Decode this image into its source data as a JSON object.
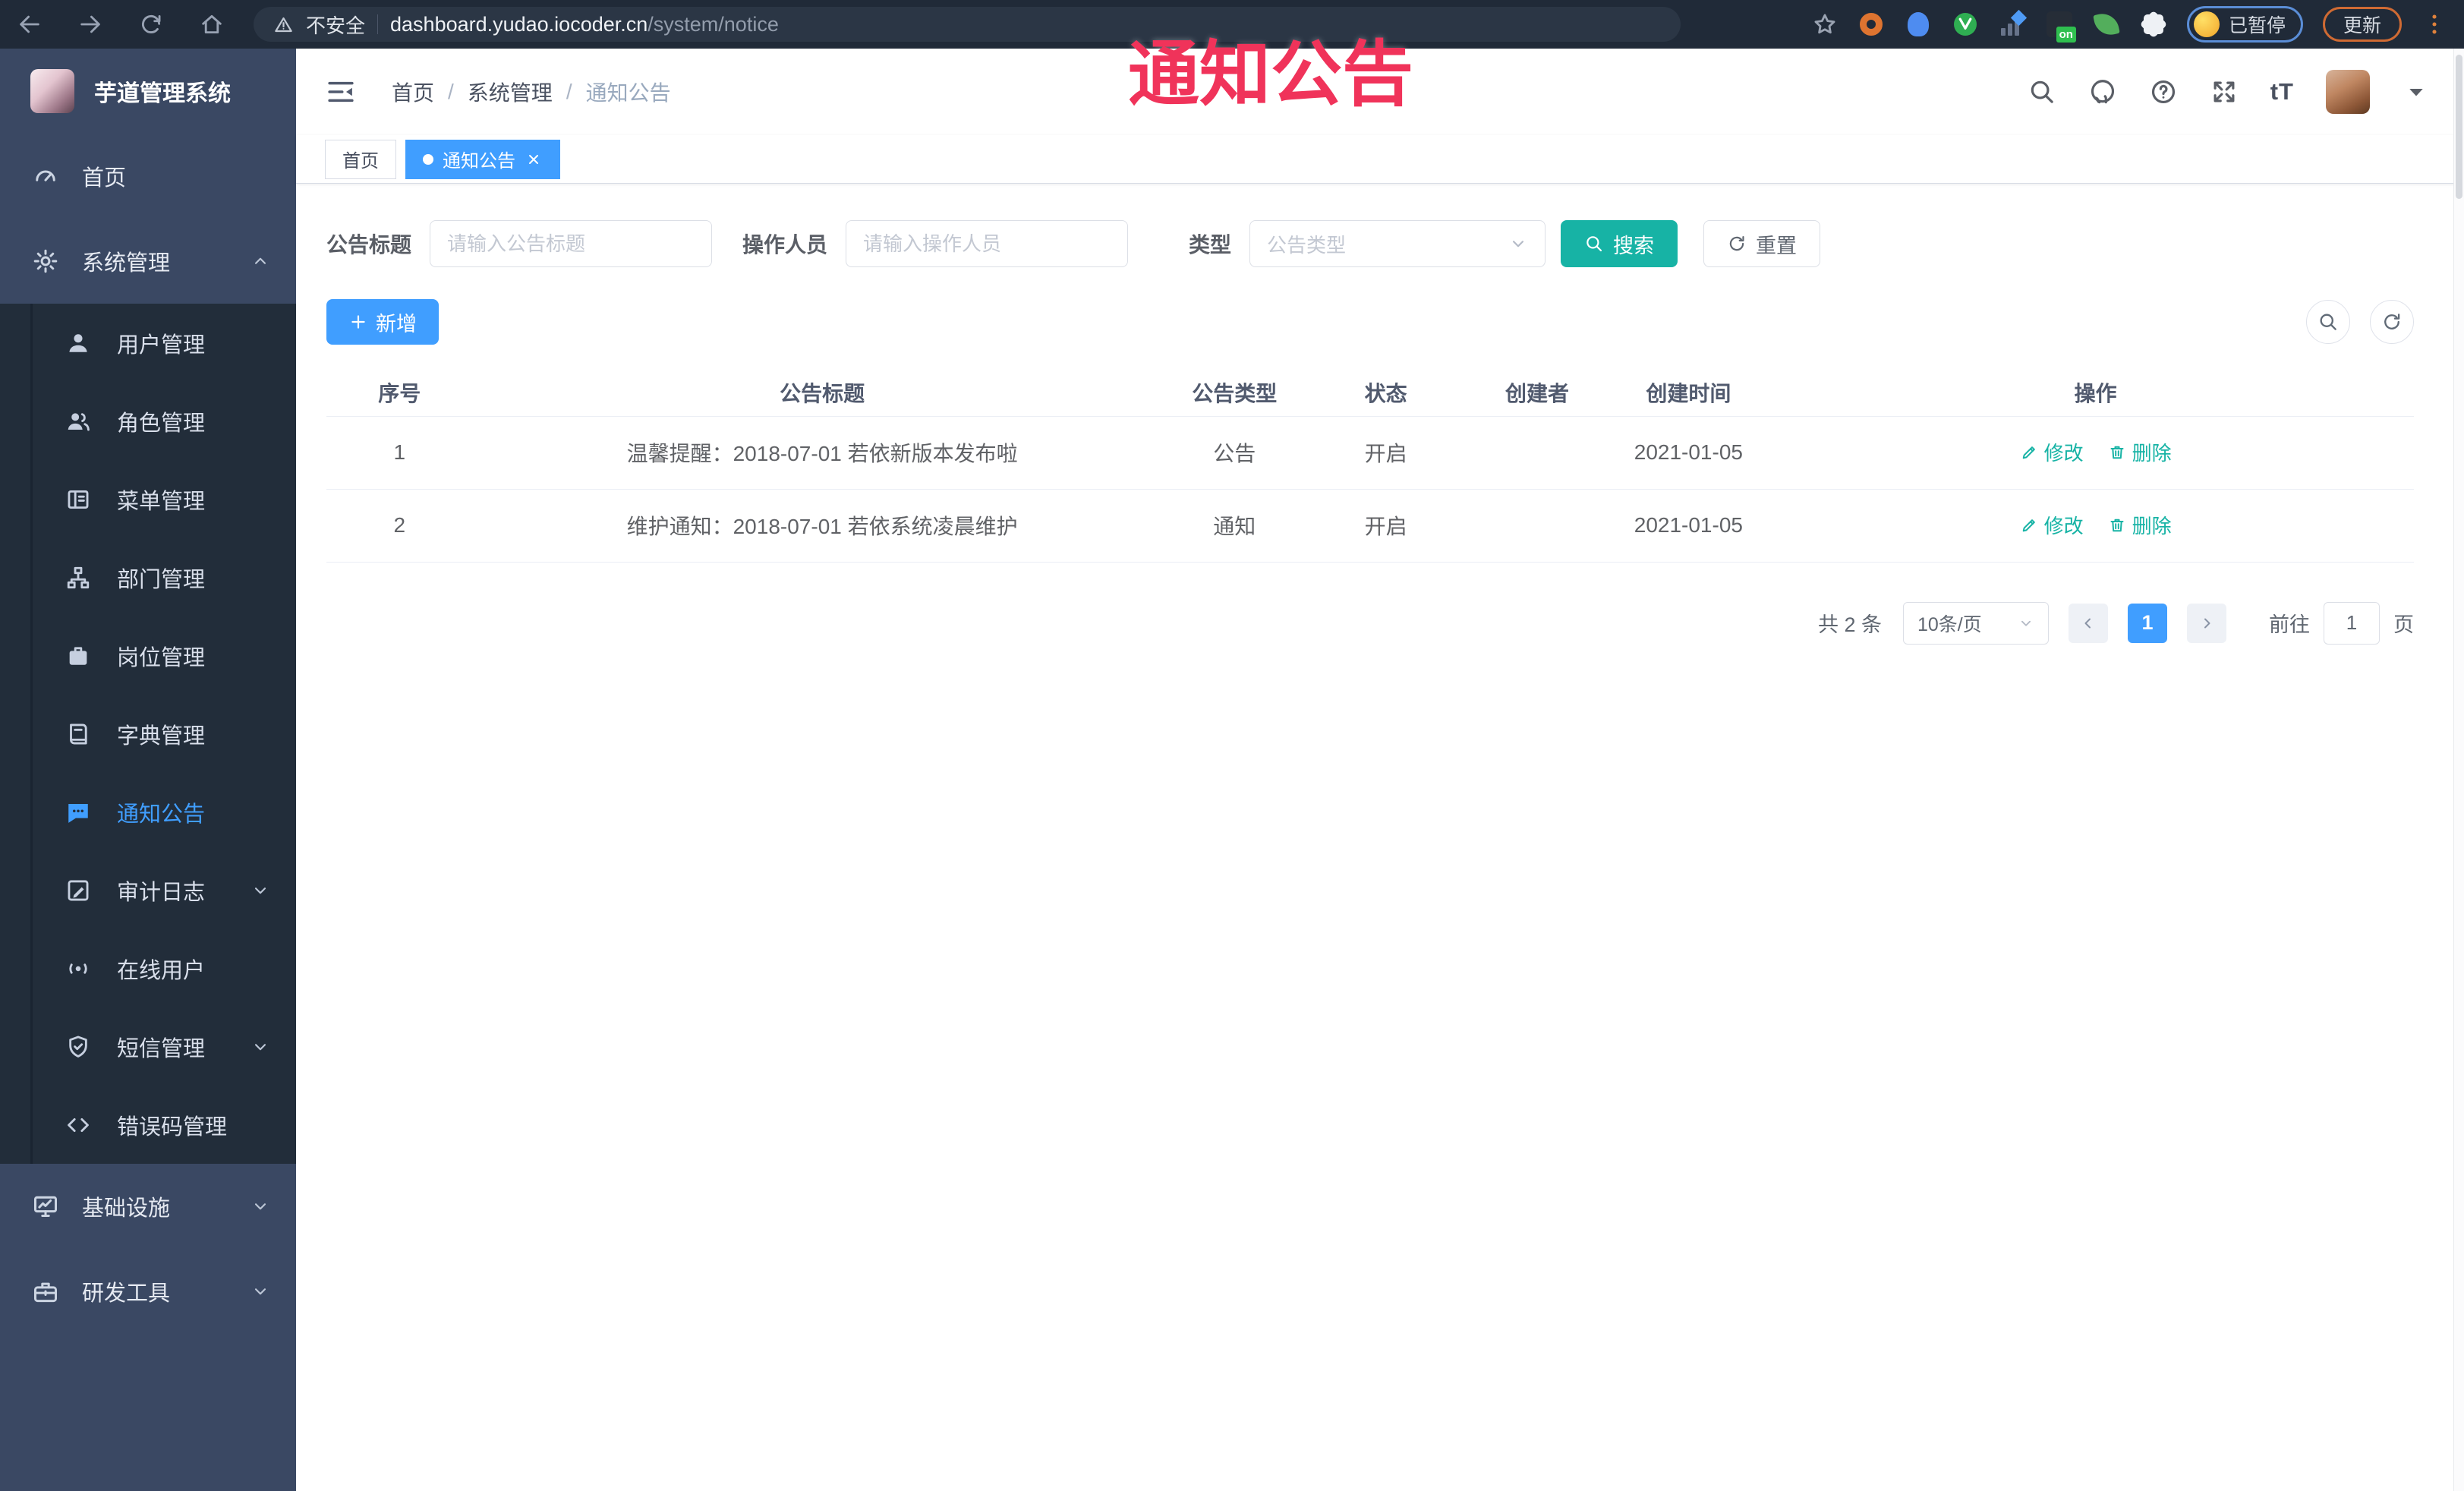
{
  "overlay_title": "通知公告",
  "browser": {
    "security_label": "不安全",
    "url_host": "dashboard.yudao.iocoder.cn",
    "url_path": "/system/notice",
    "ext_on_badge": "on",
    "profile_status": "已暂停",
    "update_label": "更新"
  },
  "sidebar": {
    "app_title": "芋道管理系统",
    "items": [
      {
        "name": "home",
        "label": "首页",
        "icon": "dashboard-icon",
        "level": 1
      },
      {
        "name": "system-management",
        "label": "系统管理",
        "icon": "gear-icon",
        "level": 1,
        "expanded": true
      },
      {
        "name": "user-management",
        "label": "用户管理",
        "icon": "user-icon",
        "level": 2
      },
      {
        "name": "role-management",
        "label": "角色管理",
        "icon": "users-icon",
        "level": 2
      },
      {
        "name": "menu-management",
        "label": "菜单管理",
        "icon": "menu-list-icon",
        "level": 2
      },
      {
        "name": "dept-management",
        "label": "部门管理",
        "icon": "org-tree-icon",
        "level": 2
      },
      {
        "name": "post-management",
        "label": "岗位管理",
        "icon": "badge-icon",
        "level": 2
      },
      {
        "name": "dict-management",
        "label": "字典管理",
        "icon": "dictionary-icon",
        "level": 2
      },
      {
        "name": "notice-announcement",
        "label": "通知公告",
        "icon": "notice-icon",
        "level": 2,
        "active": true
      },
      {
        "name": "audit-log",
        "label": "审计日志",
        "icon": "audit-log-icon",
        "level": 2,
        "collapsible": true
      },
      {
        "name": "online-users",
        "label": "在线用户",
        "icon": "online-user-icon",
        "level": 2
      },
      {
        "name": "sms-management",
        "label": "短信管理",
        "icon": "sms-icon",
        "level": 2,
        "collapsible": true
      },
      {
        "name": "error-code-management",
        "label": "错误码管理",
        "icon": "error-code-icon",
        "level": 2
      },
      {
        "name": "infrastructure",
        "label": "基础设施",
        "icon": "infrastructure-icon",
        "level": 1,
        "collapsible": true
      },
      {
        "name": "dev-tools",
        "label": "研发工具",
        "icon": "dev-tools-icon",
        "level": 1,
        "collapsible": true
      }
    ]
  },
  "header": {
    "breadcrumb": [
      "首页",
      "系统管理",
      "通知公告"
    ],
    "separator": "/",
    "font_size_glyph": "tT"
  },
  "tabs": [
    {
      "name": "home",
      "label": "首页",
      "active": false,
      "closable": false
    },
    {
      "name": "notice",
      "label": "通知公告",
      "active": true,
      "closable": true
    }
  ],
  "filters": {
    "title_label": "公告标题",
    "title_placeholder": "请输入公告标题",
    "operator_label": "操作人员",
    "operator_placeholder": "请输入操作人员",
    "type_label": "类型",
    "type_placeholder": "公告类型",
    "search_label": "搜索",
    "reset_label": "重置"
  },
  "toolbar": {
    "add_label": "新增"
  },
  "table": {
    "columns": [
      "序号",
      "公告标题",
      "公告类型",
      "状态",
      "创建者",
      "创建时间",
      "操作"
    ],
    "rows": [
      {
        "index": "1",
        "title": "温馨提醒：2018-07-01 若依新版本发布啦",
        "type": "公告",
        "status": "开启",
        "creator": "",
        "created_at": "2021-01-05"
      },
      {
        "index": "2",
        "title": "维护通知：2018-07-01 若依系统凌晨维护",
        "type": "通知",
        "status": "开启",
        "creator": "",
        "created_at": "2021-01-05"
      }
    ],
    "actions": {
      "edit": "修改",
      "delete": "删除"
    }
  },
  "pagination": {
    "total_text": "共 2 条",
    "page_size": "10条/页",
    "current_page": "1",
    "goto_label": "前往",
    "goto_value": "1",
    "unit_label": "页"
  },
  "colors": {
    "accent": "#409eff",
    "success_teal": "#17b3a5",
    "overlay_red": "#f0335a",
    "sidebar_bg": "#3a4863",
    "sidebar_submenu_bg": "#222d3a",
    "chrome_bg": "#202a38"
  }
}
